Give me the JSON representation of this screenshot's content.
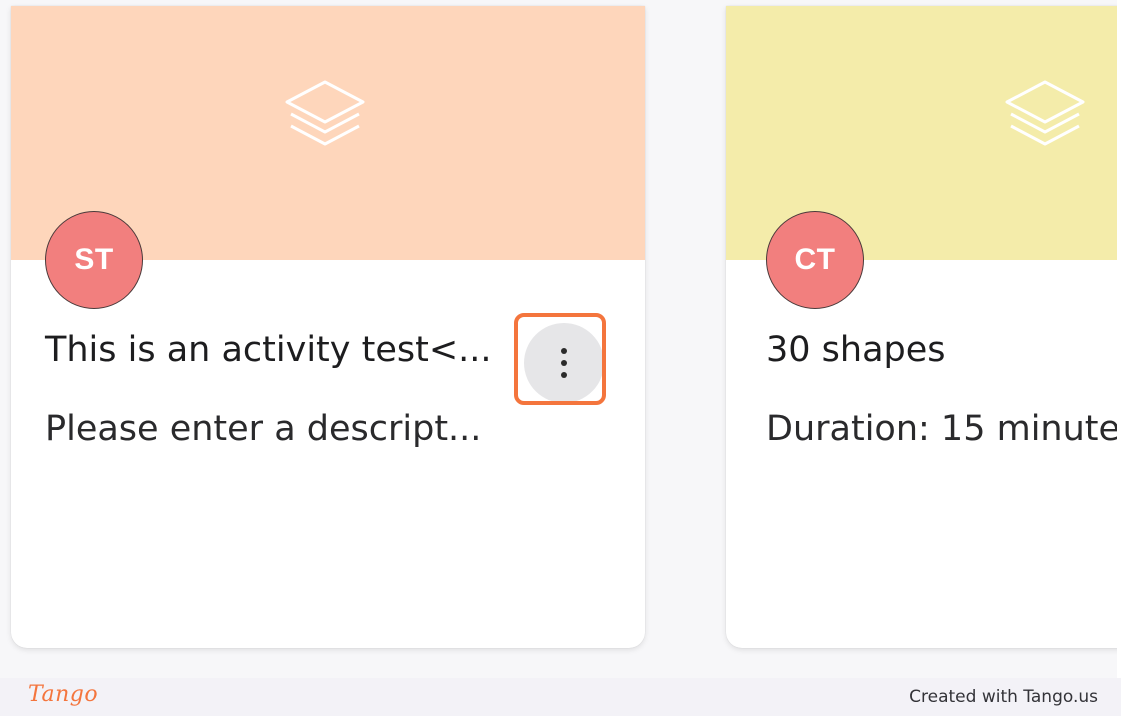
{
  "colors": {
    "card1_banner": "#fed6bb",
    "card2_banner": "#f4ecaa",
    "avatar": "#f27f7e",
    "highlight": "#f4753d",
    "menu_button_bg": "#e6e6e8"
  },
  "cards": [
    {
      "icon": "layers-icon",
      "avatar_initials": "ST",
      "title": "This is an activity test<...",
      "description": "Please enter a descript..."
    },
    {
      "icon": "layers-icon",
      "avatar_initials": "CT",
      "title": "30 shapes",
      "description": "Duration: 15 minute"
    }
  ],
  "card_menu": {
    "icon": "more-vertical-icon"
  },
  "footer": {
    "logo": "Tango",
    "credit": "Created with Tango.us"
  }
}
